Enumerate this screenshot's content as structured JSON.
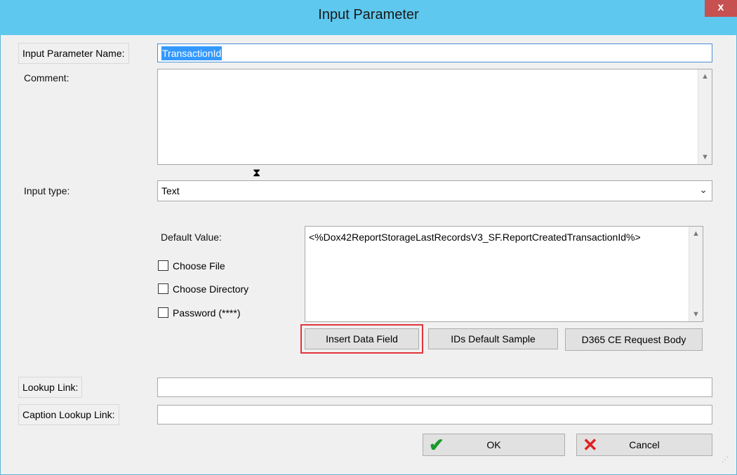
{
  "window": {
    "title": "Input Parameter",
    "close_label": "x"
  },
  "form": {
    "name_label": "Input Parameter Name:",
    "name_value": "TransactionId",
    "comment_label": "Comment:",
    "comment_value": "",
    "input_type_label": "Input type:",
    "input_type_value": "Text",
    "default_value_label": "Default Value:",
    "default_value": "<%Dox42ReportStorageLastRecordsV3_SF.ReportCreatedTransactionId%>",
    "choose_file_label": "Choose File",
    "choose_directory_label": "Choose Directory",
    "password_label": "Password (****)",
    "lookup_link_label": "Lookup Link:",
    "caption_lookup_link_label": "Caption Lookup Link:"
  },
  "buttons": {
    "insert_data_field": "Insert Data Field",
    "ids_default_sample": "IDs Default Sample",
    "d365_request_body": "D365 CE Request Body",
    "ok": "OK",
    "cancel": "Cancel"
  },
  "icons": {
    "scroll_up": "▲",
    "scroll_down": "▼",
    "dropdown": "⌄",
    "ok": "✔",
    "cancel": "✕",
    "hourglass": "⧗",
    "grip": "⋰"
  },
  "colors": {
    "titlebar": "#5ec8ee",
    "selection": "#3399ff",
    "highlight": "#e0353b",
    "ok_check": "#1a9a2a",
    "cancel_x": "#e02020"
  }
}
